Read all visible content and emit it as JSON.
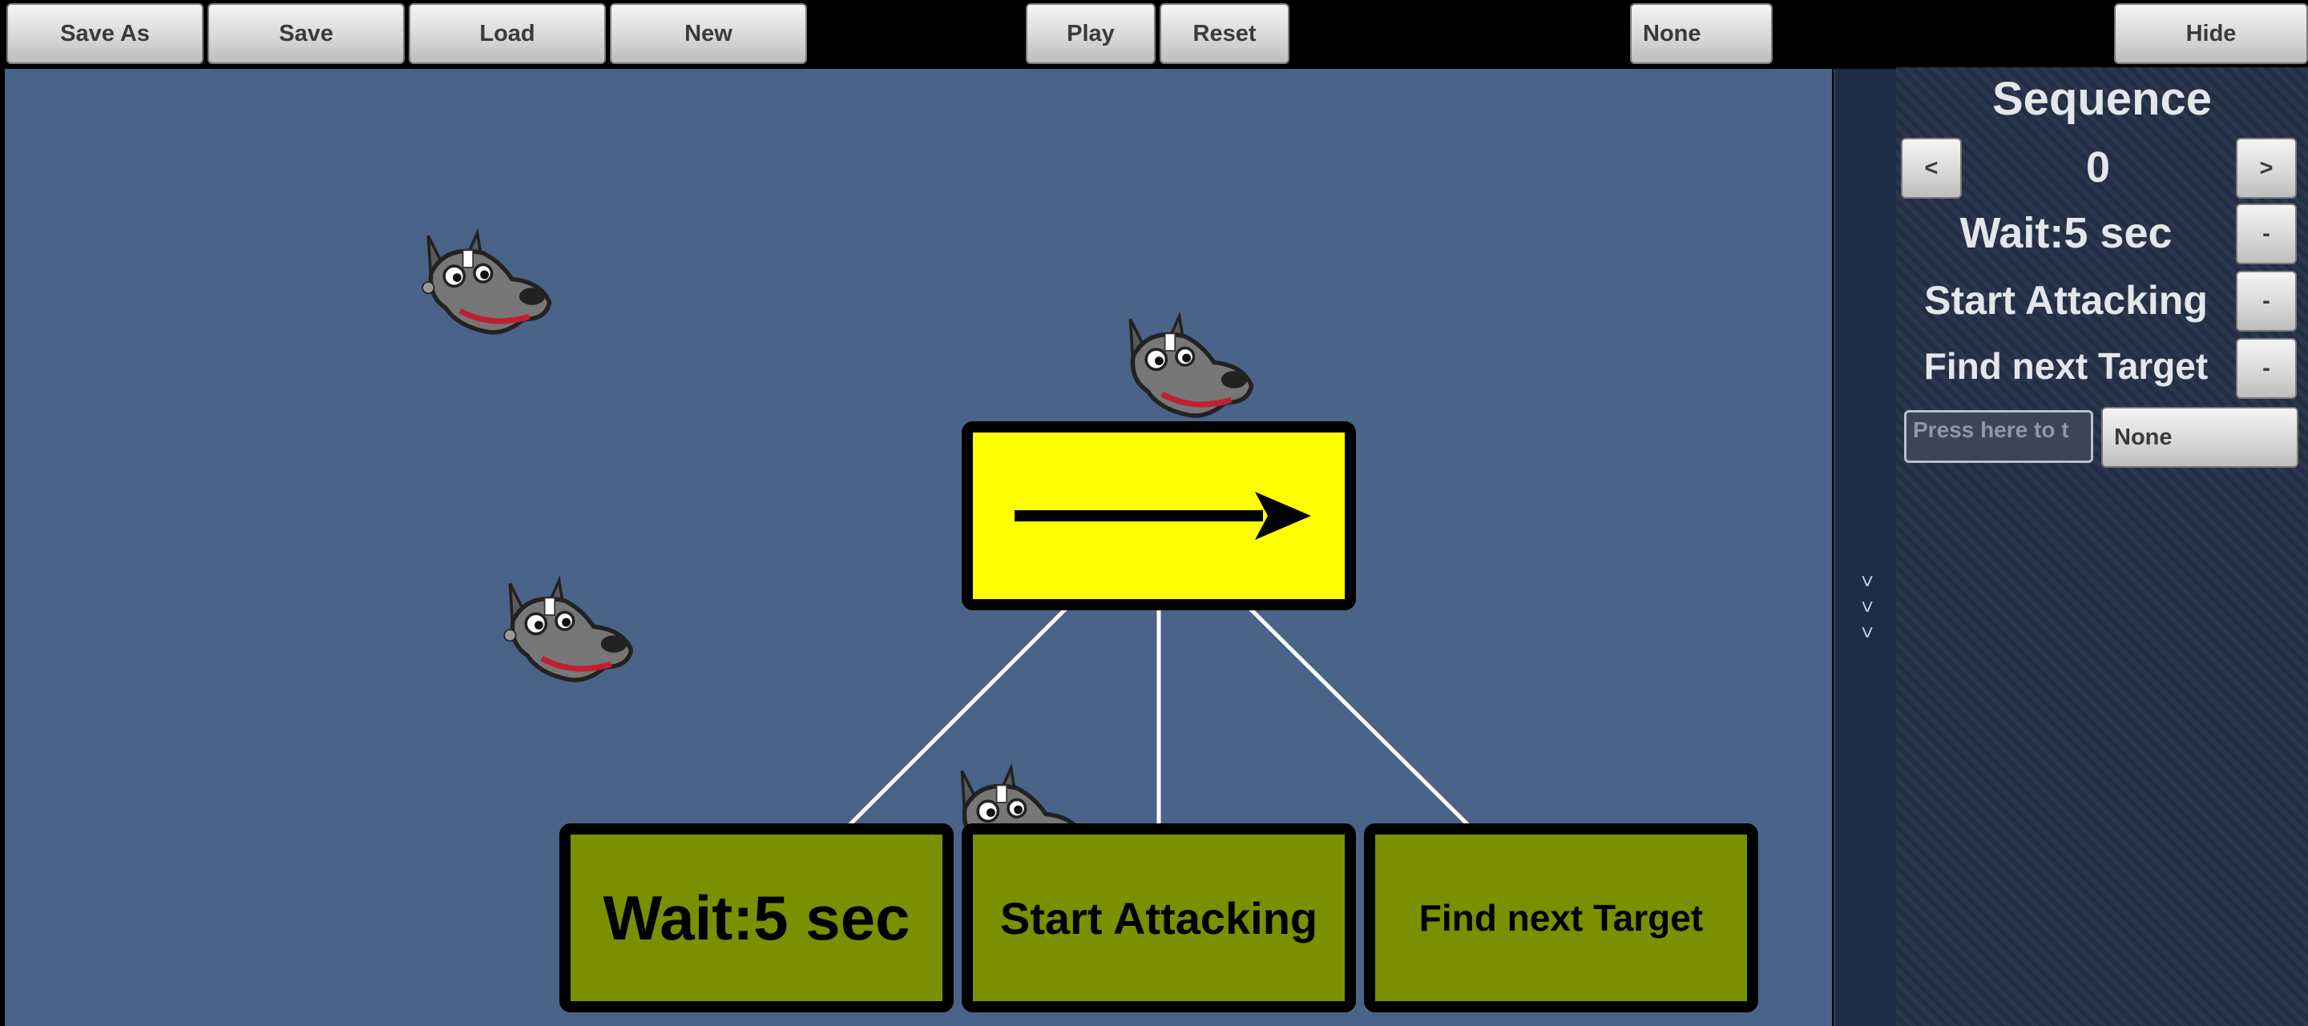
{
  "toolbar": {
    "save_as": "Save As",
    "save": "Save",
    "load": "Load",
    "new": "New",
    "play": "Play",
    "reset": "Reset",
    "selector": "None",
    "hide": "Hide"
  },
  "tree": {
    "root_type": "Sequence",
    "children": [
      "Wait:5 sec",
      "Start Attacking",
      "Find next Target"
    ]
  },
  "panel": {
    "title": "Sequence",
    "prev_label": "<",
    "next_label": ">",
    "index": "0",
    "children": [
      {
        "label": "Wait:5 sec",
        "remove": "-"
      },
      {
        "label": "Start Attacking",
        "remove": "-"
      },
      {
        "label": "Find next Target",
        "remove": "-"
      }
    ],
    "input_placeholder": "Press here to t",
    "dropdown_value": "None"
  },
  "collapse_handle": {
    "chevrons": [
      ">",
      ">",
      ">"
    ]
  },
  "colors": {
    "canvas": "#4a6389",
    "root_node": "#ffff00",
    "leaf_node": "#7a9000",
    "panel": "#233047"
  },
  "icons": {
    "wolf": "wolf-head-icon",
    "arrow": "arrow-right-icon"
  }
}
